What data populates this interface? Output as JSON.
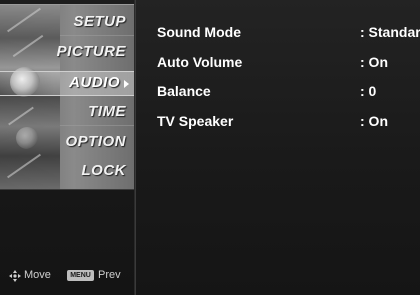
{
  "menu": {
    "items": [
      {
        "label": "SETUP",
        "active": false
      },
      {
        "label": "PICTURE",
        "active": false
      },
      {
        "label": "AUDIO",
        "active": true
      },
      {
        "label": "TIME",
        "active": false
      },
      {
        "label": "OPTION",
        "active": false
      },
      {
        "label": "LOCK",
        "active": false
      }
    ],
    "selected_arrow_icon": "arrow-right-icon"
  },
  "hint": {
    "move_icon": "four-way-arrow-icon",
    "move_label": "Move",
    "menu_key_label": "MENU",
    "prev_label": "Prev"
  },
  "audio_settings": {
    "rows": [
      {
        "name": "Sound Mode",
        "value": ": Standard"
      },
      {
        "name": "Auto Volume",
        "value": ": On"
      },
      {
        "name": "Balance",
        "value": ": 0"
      },
      {
        "name": "TV Speaker",
        "value": ": On"
      }
    ]
  }
}
